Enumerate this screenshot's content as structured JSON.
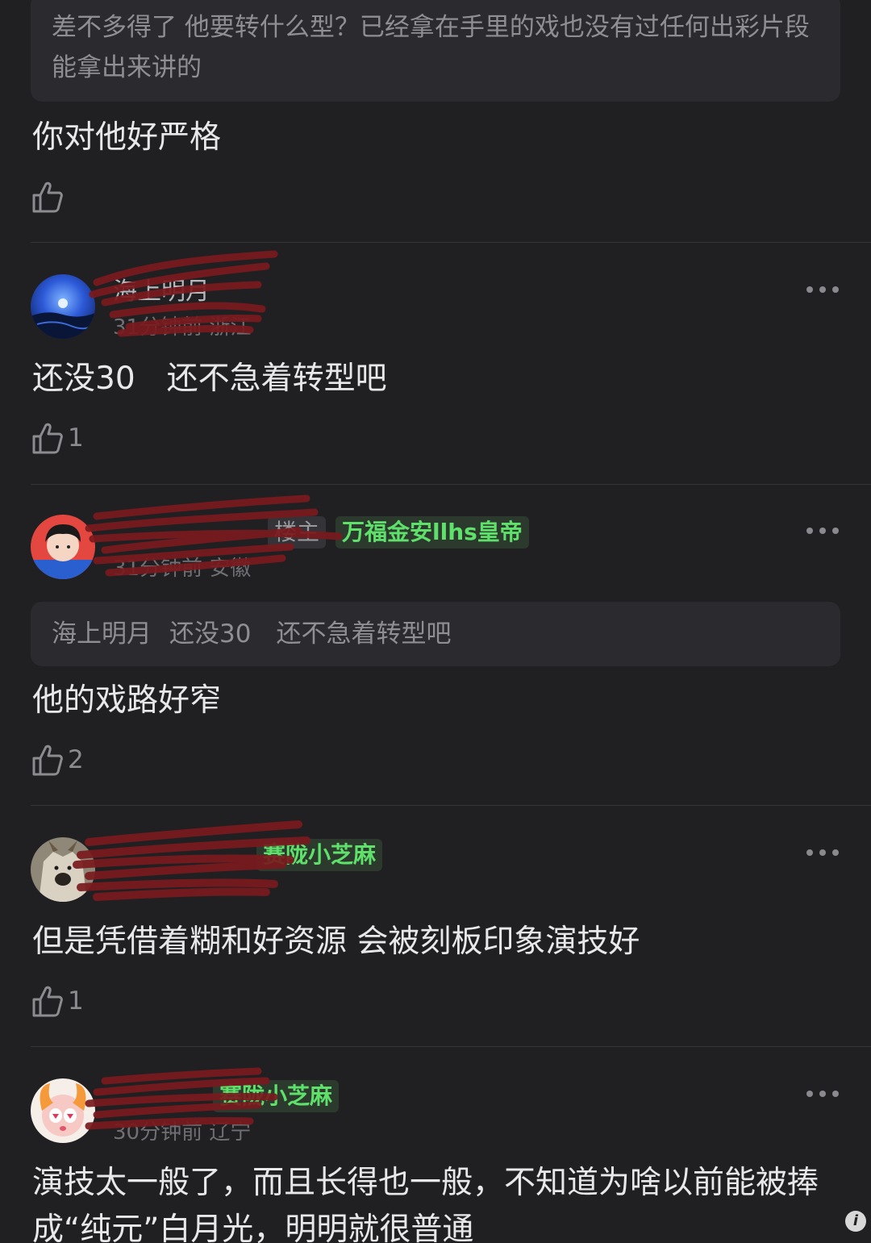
{
  "thread": {
    "top_quote": "差不多得了 他要转什么型？已经拿在手里的戏也没有过任何出彩片段能拿出来讲的",
    "top_comment": {
      "text": "你对他好严格",
      "likes": ""
    },
    "comments": [
      {
        "name": "海上明月",
        "time_location": "31分钟前 浙江",
        "badges": [],
        "text": "还没30　还不急着转型吧",
        "likes": "1"
      },
      {
        "name": "",
        "time_location": "31分钟前 安徽",
        "badges": [
          "楼主",
          "万福金安llhs皇帝"
        ],
        "reply_to_name": "海上明月",
        "reply_to_text": "还没30　还不急着转型吧",
        "text": "他的戏路好窄",
        "likes": "2"
      },
      {
        "name": "",
        "time_location": "",
        "badges": [
          "赛陇小芝麻"
        ],
        "text": "但是凭借着糊和好资源  会被刻板印象演技好",
        "likes": "1"
      },
      {
        "name": "",
        "time_location": "30分钟前 辽宁",
        "badges": [
          "赛陇小芝麻"
        ],
        "text": "演技太一般了，而且长得也一般，不知道为啥以前能被捧成“纯元”白月光，明明就很普通"
      }
    ]
  },
  "colors": {
    "background": "#202023",
    "badge_green": "#5ee06a",
    "redaction": "#7a1a1e"
  },
  "icons": {
    "like": "thumbs-up-icon",
    "more": "more-dots-icon"
  }
}
